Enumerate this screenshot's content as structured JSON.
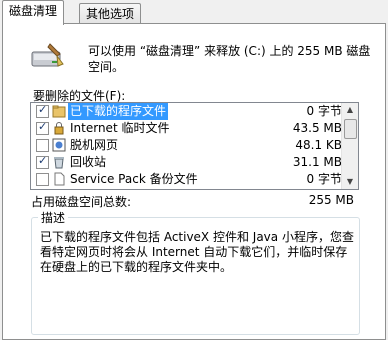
{
  "tabs": [
    {
      "label": "磁盘清理",
      "active": true
    },
    {
      "label": "其他选项",
      "active": false
    }
  ],
  "info": {
    "icon": "disk-cleanup-icon",
    "text": "可以使用 “磁盘清理” 来释放 (C:) 上的 255 MB 磁盘空间。"
  },
  "files_to_delete_label": "要删除的文件(F):",
  "file_list": [
    {
      "name": "已下载的程序文件",
      "size": "0 字节",
      "checked": true,
      "selected": true,
      "icon": "folder-icon"
    },
    {
      "name": "Internet 临时文件",
      "size": "43.5 MB",
      "checked": true,
      "selected": false,
      "icon": "lock-icon"
    },
    {
      "name": "脱机网页",
      "size": "48.1 KB",
      "checked": false,
      "selected": false,
      "icon": "offline-page-icon"
    },
    {
      "name": "回收站",
      "size": "31.1 MB",
      "checked": true,
      "selected": false,
      "icon": "recycle-bin-icon"
    },
    {
      "name": "Service Pack 备份文件",
      "size": "0 字节",
      "checked": false,
      "selected": false,
      "icon": "file-icon"
    }
  ],
  "total": {
    "label": "占用磁盘空间总数:",
    "value": "255 MB"
  },
  "description": {
    "title": "描述",
    "text": "已下载的程序文件包括 ActiveX 控件和 Java 小程序，您查看特定网页时将会从 Internet 自动下载它们，并临时保存在硬盘上的已下载的程序文件夹中。"
  },
  "colors": {
    "selection": "#3399ff",
    "border": "#8e8f8f"
  }
}
